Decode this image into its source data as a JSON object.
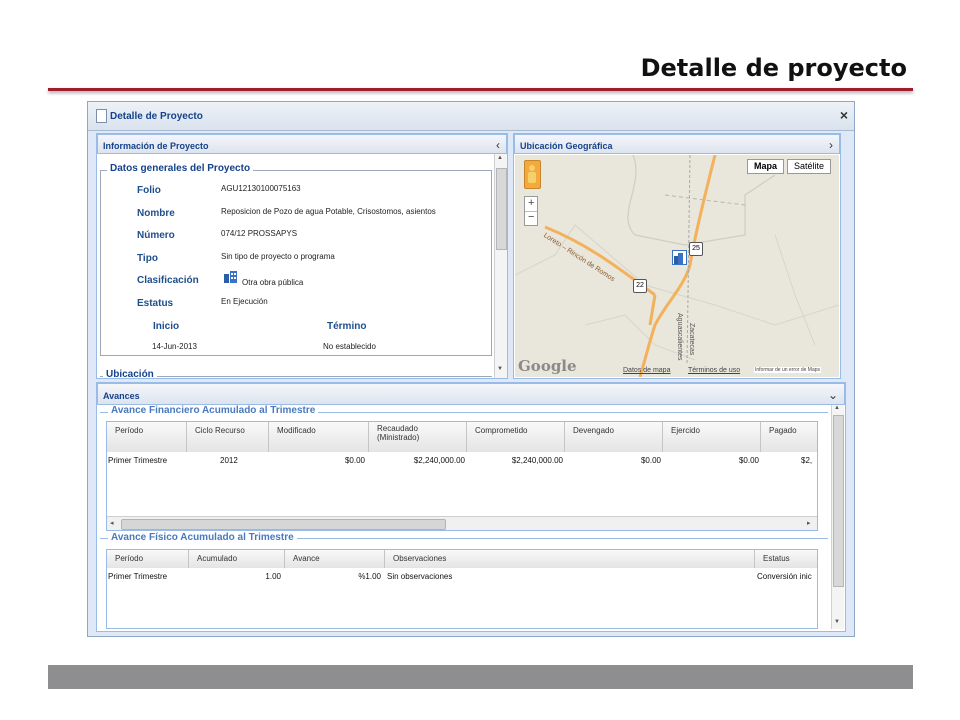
{
  "slide_title": "Detalle de proyecto",
  "window": {
    "title": "Detalle de Proyecto",
    "close_icon": "×"
  },
  "info_panel": {
    "title": "Información de Proyecto",
    "collapse_icon": "‹",
    "section_title": "Datos generales del Proyecto",
    "fields": [
      {
        "label": "Folio",
        "value": "AGU12130100075163"
      },
      {
        "label": "Nombre",
        "value": "Reposicion de Pozo de agua Potable, Crisostomos, asientos"
      },
      {
        "label": "Número",
        "value": "074/12 PROSSAPYS"
      },
      {
        "label": "Tipo",
        "value": "Sin tipo de proyecto o programa"
      },
      {
        "label": "Clasificación",
        "value": "Otra obra pública"
      },
      {
        "label": "Estatus",
        "value": "En Ejecución"
      }
    ],
    "inicio_label": "Inicio",
    "inicio_value": "14-Jun-2013",
    "termino_label": "Término",
    "termino_value": "No establecido",
    "ubicacion_title": "Ubicación"
  },
  "map_panel": {
    "title": "Ubicación Geográfica",
    "expand_icon": "›",
    "btn_mapa": "Mapa",
    "btn_satelite": "Satélite",
    "road_label": "Loreto – Rincón de Romos",
    "route_22": "22",
    "route_25": "25",
    "road_vertical_1": "Aguascalientes",
    "road_vertical_2": "Zacatecas",
    "logo": "Google",
    "datos": "Datos de mapa",
    "terminos": "Términos de uso",
    "informar": "Informar de un error de Maps",
    "colors": {
      "road": "#f2b15a",
      "water": "#b0c4d8"
    }
  },
  "avances": {
    "title": "Avances",
    "collapse_icon": "⌄",
    "financiero": {
      "title": "Avance Financiero Acumulado al Trimestre",
      "headers": [
        "Período",
        "Ciclo Recurso",
        "Modificado",
        "Recaudado\n(Ministrado)",
        "Comprometido",
        "Devengado",
        "Ejercido",
        "Pagado"
      ],
      "rows": [
        [
          "Primer Trimestre",
          "2012",
          "$0.00",
          "$2,240,000.00",
          "$2,240,000.00",
          "$0.00",
          "$0.00",
          "$2,"
        ]
      ]
    },
    "fisico": {
      "title": "Avance Físico Acumulado al Trimestre",
      "headers": [
        "Período",
        "Acumulado",
        "Avance",
        "Observaciones",
        "Estatus"
      ],
      "rows": [
        [
          "Primer Trimestre",
          "1.00",
          "%1.00",
          "Sin observaciones",
          "Conversión inic"
        ]
      ]
    }
  }
}
